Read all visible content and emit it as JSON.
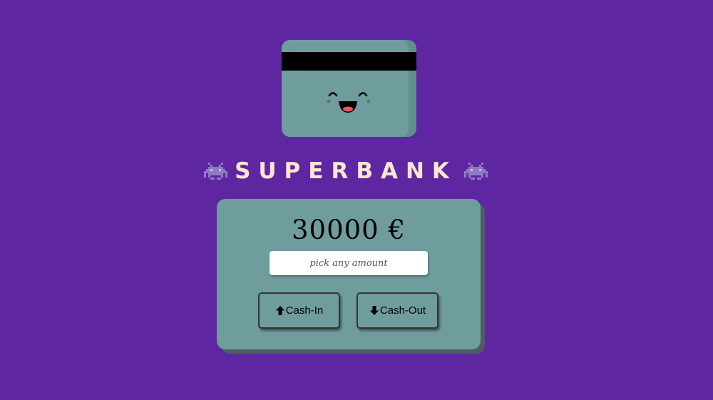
{
  "title": "SUPERBANK",
  "balance": {
    "amount": "30000",
    "currency": "€"
  },
  "amount_input": {
    "placeholder": "pick any amount",
    "value": ""
  },
  "actions": {
    "cash_in_label": "Cash-In",
    "cash_in_icon": "up-arrow-icon",
    "cash_out_label": "Cash-Out",
    "cash_out_icon": "down-arrow-icon"
  },
  "icons": {
    "title_left": "space-invader-icon",
    "title_right": "space-invader-icon",
    "card": "happy-credit-card-icon"
  },
  "colors": {
    "background": "#5e27a1",
    "panel": "#6f9d9d",
    "title": "#fbe6d4"
  }
}
